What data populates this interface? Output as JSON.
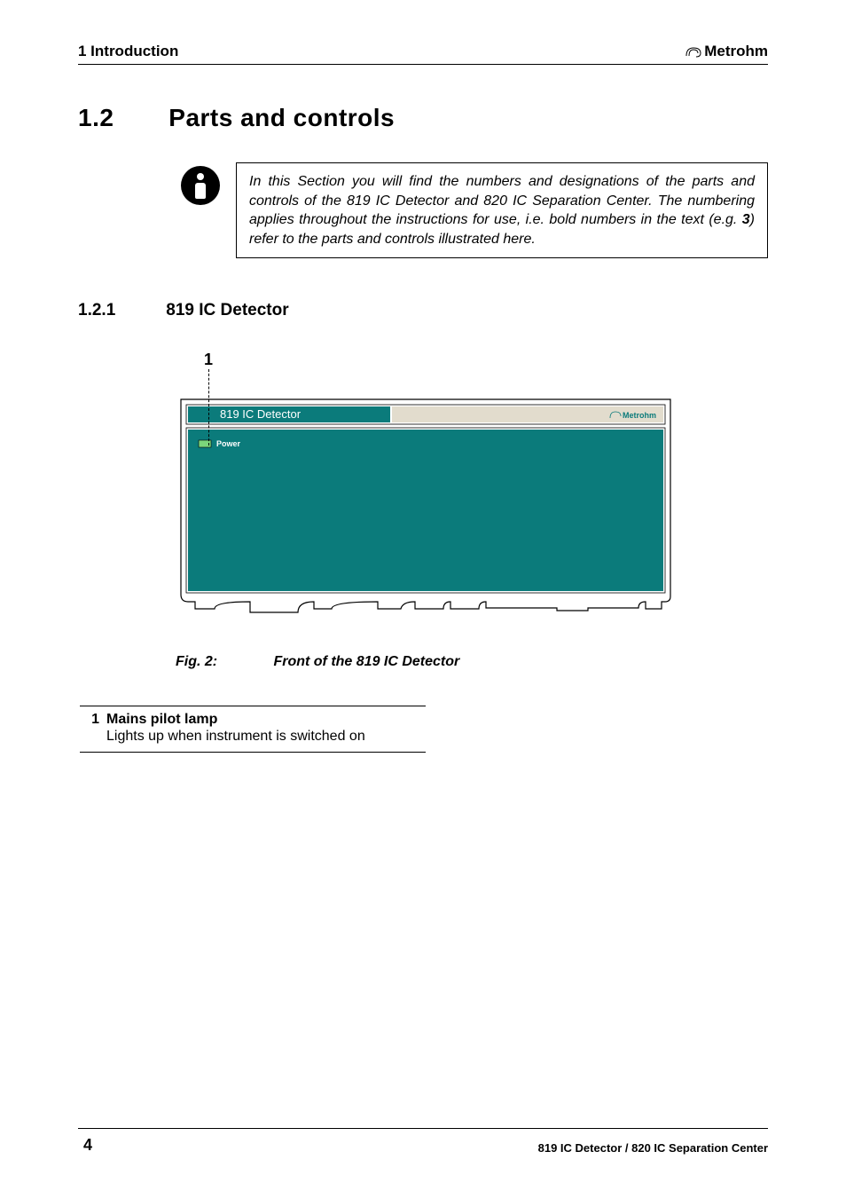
{
  "header": {
    "chapter": "1 Introduction",
    "brand": "Metrohm"
  },
  "section": {
    "number": "1.2",
    "title": "Parts and controls"
  },
  "infoBox": {
    "text_before": "In this Section you will find the numbers and designations of the parts and controls of the 819 IC Detector and 820 IC Separation Center. The numbering applies throughout the instructions for use, i.e. bold numbers in the text (e.g. ",
    "bold_ref": "3",
    "text_after": ") refer to the parts and controls illustrated here."
  },
  "subsection": {
    "number": "1.2.1",
    "title": "819 IC Detector"
  },
  "figure": {
    "callout_number": "1",
    "device_label": "819 IC Detector",
    "device_brand": "Metrohm",
    "power_label": "Power",
    "caption_num": "Fig. 2:",
    "caption_text": "Front of the 819 IC Detector"
  },
  "parts": {
    "items": [
      {
        "num": "1",
        "title": "Mains pilot lamp",
        "desc": "Lights up when instrument is switched on"
      }
    ]
  },
  "footer": {
    "page": "4",
    "doc": "819 IC Detector / 820 IC Separation Center"
  }
}
